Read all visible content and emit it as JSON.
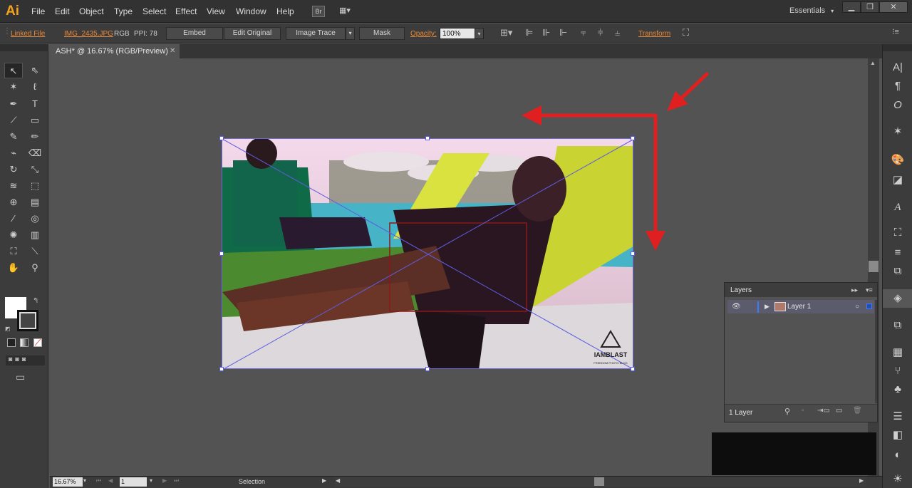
{
  "app": {
    "logo": "Ai",
    "brand_color": "#f7a21b"
  },
  "menu": [
    "File",
    "Edit",
    "Object",
    "Type",
    "Select",
    "Effect",
    "View",
    "Window",
    "Help"
  ],
  "toolbar_top": {
    "bridge": "Br",
    "workspace": "Essentials"
  },
  "control_bar": {
    "linked_file": "Linked File",
    "filename": "IMG_2435.JPG",
    "color_mode": "RGB",
    "ppi": "PPI: 78",
    "embed": "Embed",
    "edit_original": "Edit Original",
    "image_trace": "Image Trace",
    "mask": "Mask",
    "opacity_label": "Opacity:",
    "opacity_value": "100%",
    "transform": "Transform"
  },
  "document_tab": {
    "title": "ASH* @ 16.67% (RGB/Preview)"
  },
  "status_bar": {
    "zoom": "16.67%",
    "page": "1",
    "tool_status": "Selection"
  },
  "layers_panel": {
    "title": "Layers",
    "layer_name": "Layer 1",
    "count": "1 Layer"
  },
  "artwork": {
    "watermark_line1": "IAMBLAST",
    "watermark_line2": "FREEDOM PHOTO BLOG"
  },
  "annotation_color": "#e02020"
}
